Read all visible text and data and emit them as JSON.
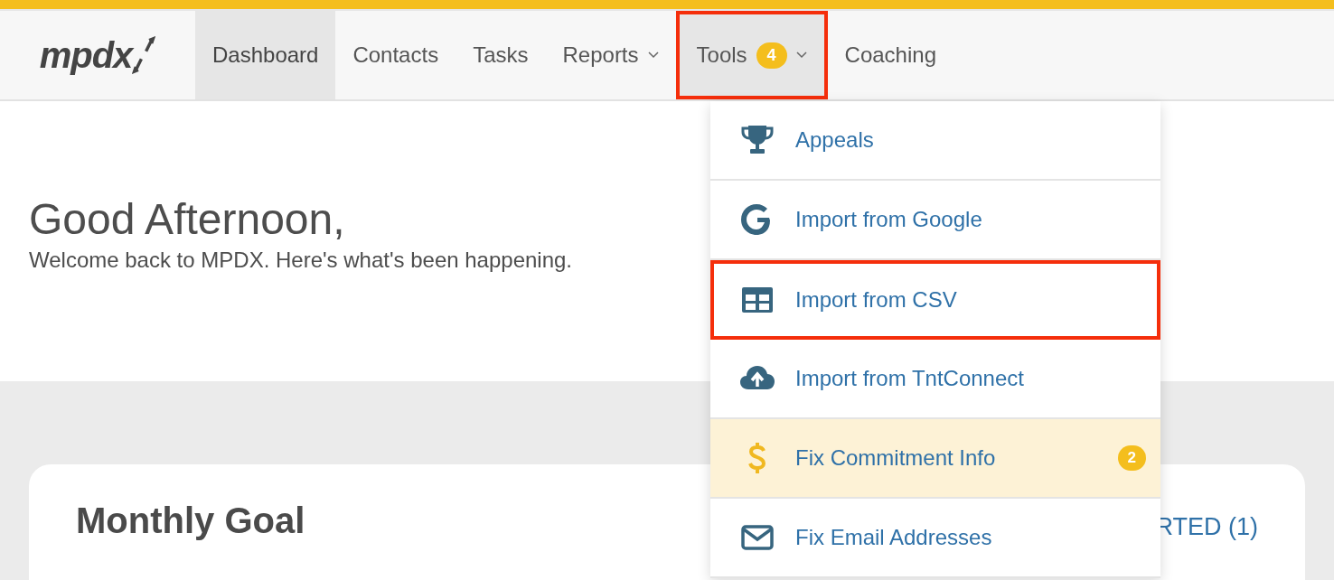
{
  "logo": {
    "text": "mpdx"
  },
  "nav": [
    {
      "label": "Dashboard",
      "selected": true,
      "dropdown": false,
      "highlighted": false
    },
    {
      "label": "Contacts",
      "selected": false,
      "dropdown": false,
      "highlighted": false
    },
    {
      "label": "Tasks",
      "selected": false,
      "dropdown": false,
      "highlighted": false
    },
    {
      "label": "Reports",
      "selected": false,
      "dropdown": true,
      "highlighted": false
    },
    {
      "label": "Tools",
      "selected": false,
      "dropdown": true,
      "badge": "4",
      "expanded": true,
      "highlighted": true
    },
    {
      "label": "Coaching",
      "selected": false,
      "dropdown": false,
      "highlighted": false
    }
  ],
  "tools_menu": [
    {
      "label": "Appeals",
      "highlighted": false,
      "attention": false
    },
    {
      "label": "Import from Google",
      "highlighted": false,
      "attention": false
    },
    {
      "label": "Import from CSV",
      "highlighted": true,
      "attention": false
    },
    {
      "label": "Import from TntConnect",
      "highlighted": false,
      "attention": false
    },
    {
      "label": "Fix Commitment Info",
      "highlighted": false,
      "attention": true,
      "badge": "2"
    },
    {
      "label": "Fix Email Addresses",
      "highlighted": false,
      "attention": false
    }
  ],
  "greeting": {
    "title": "Good Afternoon,",
    "subtitle": "Welcome back to MPDX. Here's what's been happening."
  },
  "card": {
    "title": "Monthly Goal",
    "link": "RTED (1)"
  }
}
